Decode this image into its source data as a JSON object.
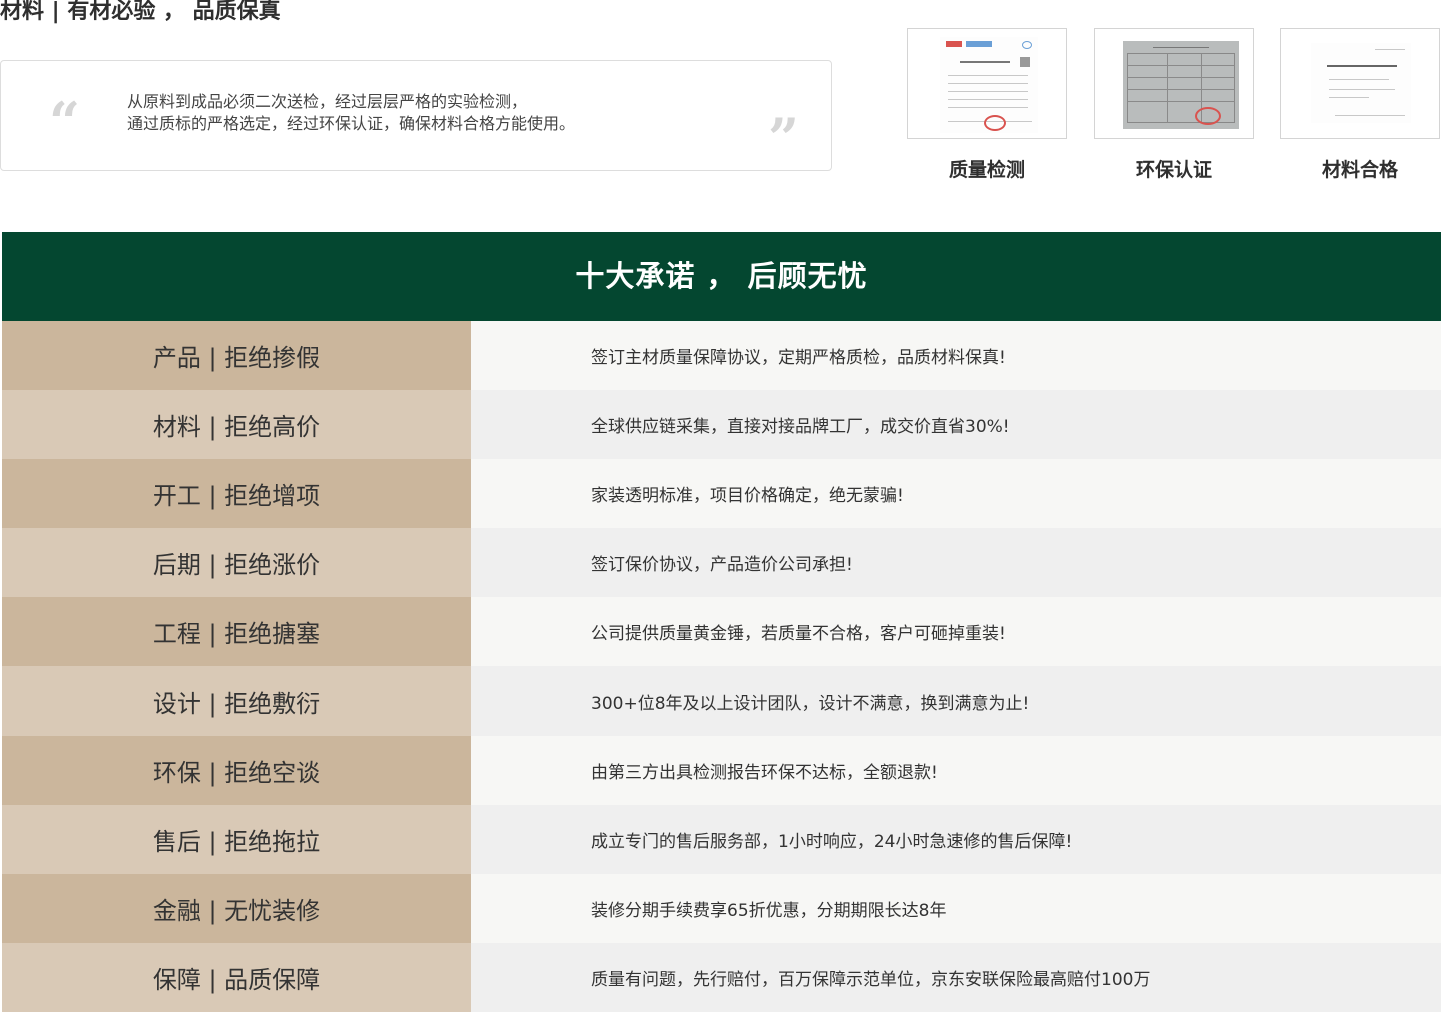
{
  "materials_section": {
    "title": "材料 | 有材必验 ， 品质保真",
    "quote_line_1": "从原料到成品必须二次送检，经过层层严格的实验检测，",
    "quote_line_2": "通过质标的严格选定，经过环保认证，确保材料合格方能使用。",
    "quote_open": "“",
    "quote_close": "”",
    "certificates": [
      {
        "label": "质量检测"
      },
      {
        "label": "环保认证"
      },
      {
        "label": "材料合格"
      }
    ]
  },
  "promises": {
    "title": "十大承诺 ， 后顾无忧",
    "rows": [
      {
        "label": "产品 | 拒绝掺假",
        "text": "签订主材质量保障协议，定期严格质检，品质材料保真!"
      },
      {
        "label": "材料 | 拒绝高价",
        "text": "全球供应链采集，直接对接品牌工厂，成交价直省30%!"
      },
      {
        "label": "开工 | 拒绝增项",
        "text": "家装透明标准，项目价格确定，绝无蒙骗!"
      },
      {
        "label": "后期 | 拒绝涨价",
        "text": "签订保价协议，产品造价公司承担!"
      },
      {
        "label": "工程 | 拒绝搪塞",
        "text": "公司提供质量黄金锤，若质量不合格，客户可砸掉重装!"
      },
      {
        "label": "设计 | 拒绝敷衍",
        "text": "300+位8年及以上设计团队，设计不满意，换到满意为止!"
      },
      {
        "label": "环保 | 拒绝空谈",
        "text": "由第三方出具检测报告环保不达标，全额退款!"
      },
      {
        "label": "售后 | 拒绝拖拉",
        "text": "成立专门的售后服务部，1小时响应，24小时急速修的售后保障!"
      },
      {
        "label": "金融 | 无忧装修",
        "text": "装修分期手续费享65折优惠，分期期限长达8年"
      },
      {
        "label": "保障 | 品质保障",
        "text": "质量有问题，先行赔付，百万保障示范单位，京东安联保险最高赔付100万"
      }
    ]
  },
  "colors": {
    "header_green": "#044730",
    "label_tan_dark": "#cbb69c",
    "label_tan_light": "#d9c9b6"
  }
}
